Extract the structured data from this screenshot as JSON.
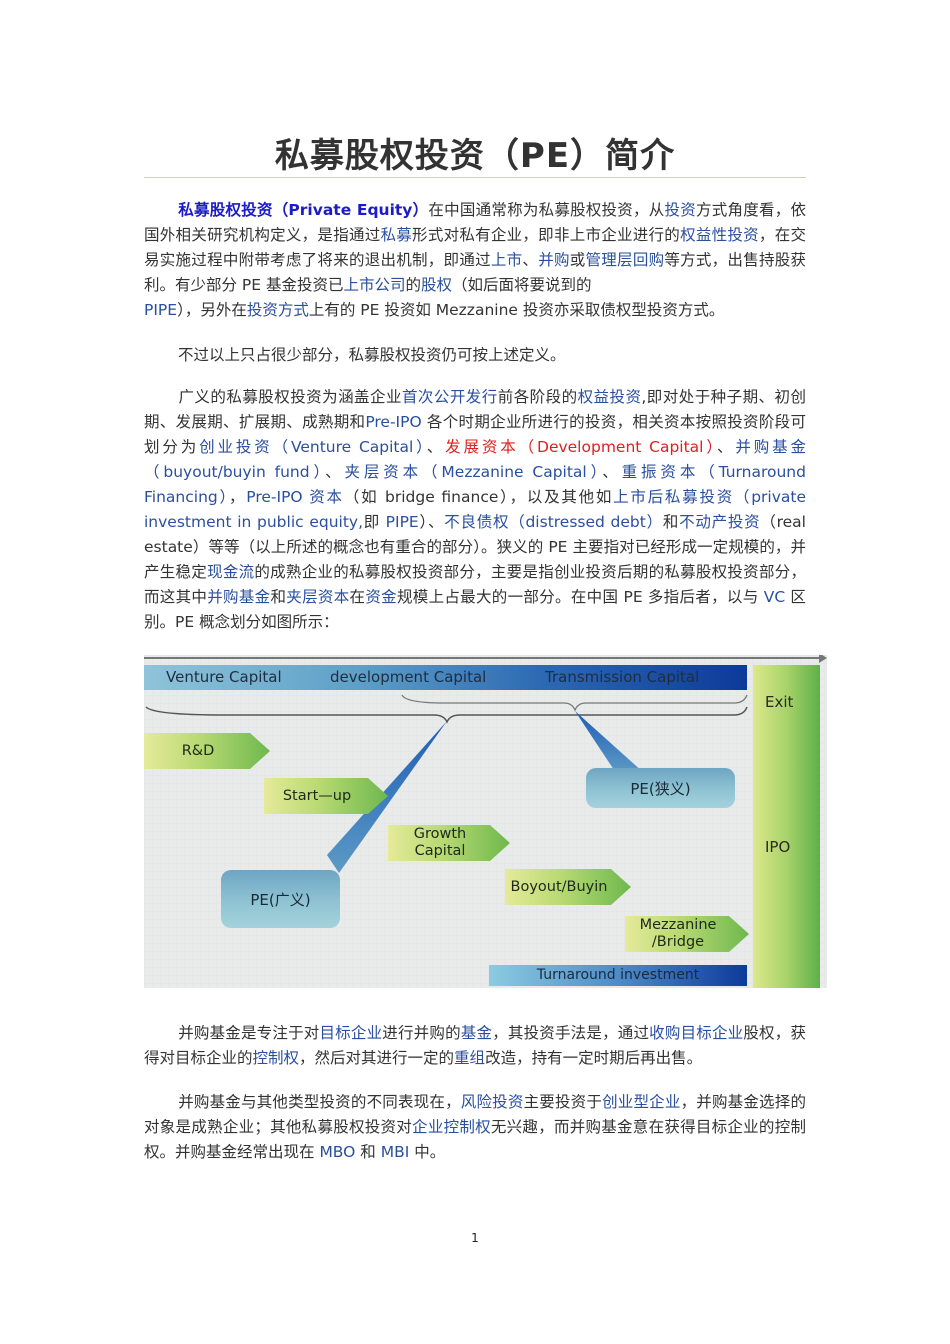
{
  "title": "私募股权投资（PE）简介",
  "paragraphs": {
    "p1": {
      "lead": "私募股权投资（Private Equity）",
      "t1": "在中国通常称为私募股权投资，从",
      "l1": "投资",
      "t2": "方式角度看，依国外相关研究机构定义，是指通过",
      "l2": "私募",
      "t3": "形式对私有企业，即非上市企业进行的",
      "l3": "权益性投资",
      "t4": "，在交易实施过程中附带考虑了将来的退出机制，即通过",
      "l4": "上市",
      "t5": "、",
      "l5": "并购",
      "t6": "或",
      "l6": "管理层回购",
      "t7": "等方式，出售持股获利。有少部分 PE 基金投资已",
      "l7": "上市公司",
      "t8": "的",
      "l8": "股权",
      "t9": "（如后面将要说到的",
      "l9": "PIPE",
      "t10": "），另外在",
      "l10": "投资方式",
      "t11": "上有的 PE 投资如 Mezzanine 投资亦采取债权型投资方式。"
    },
    "p2": {
      "text": "不过以上只占很少部分，私募股权投资仍可按上述定义。"
    },
    "p3": {
      "t1": "广义的私募股权投资为涵盖企业",
      "l1": "首次公开发行",
      "t2": "前各阶段的",
      "l2": "权益投资",
      "t3": ",即对处于种子期、初创期、发展期、扩展期、成熟期和",
      "l3": "Pre-IPO",
      "t4": " 各个时期企业所进行的投资，相关资本按照投资阶段可划分为",
      "l4": "创业投资（Venture Capital）",
      "t5": "、",
      "r1": "发展资本（Development Capital）",
      "t6": "、",
      "l5": "并购基金（buyout/buyin fund）",
      "t7": "、",
      "l6": "夹层资本（Mezzanine Capital）",
      "t8": "、",
      "l7": "重振资本（Turnaround Financing）",
      "t9": "，",
      "l8": "Pre-IPO 资本",
      "t10": "（如 bridge finance），以及其他如",
      "l9": "上市后私募投资（private investment in public equity,",
      "t11": "即 ",
      "l10": "PIPE",
      "t12": "）、",
      "l11": "不良债权（distressed debt）",
      "t13": "和",
      "l12": "不动产投资",
      "t14": "（real estate）等等（以上所述的概念也有重合的部分）。狭义的 PE 主要指对已经形成一定规模的，并产生稳定",
      "l13": "现金流",
      "t15": "的成熟企业的私募股权投资部分，主要是指创业投资后期的私募股权投资部分，而这其中",
      "l14": "并购基金",
      "t16": "和",
      "l15": "夹层资本",
      "t17": "在",
      "l16": "资金",
      "t18": "规模上占最大的一部分。在中国 PE 多指后者，以与 ",
      "l17": "VC",
      "t19": " 区别。PE 概念划分如图所示："
    },
    "p4": {
      "t1": "并购基金是专注于对",
      "l1": "目标企业",
      "t2": "进行并购的",
      "l2": "基金",
      "t3": "，其投资手法是，通过",
      "l3": "收购目标企业",
      "t4": "股权，获得对目标企业的",
      "l4": "控制权",
      "t5": "，然后对其进行一定的",
      "l5": "重组",
      "t6": "改造，持有一定时期后再出售。"
    },
    "p5": {
      "t1": "并购基金与其他类型投资的不同表现在，",
      "l1": "风险投资",
      "t2": "主要投资于",
      "l2": "创业型企业",
      "t3": "，并购基金选择的对象是成熟企业；其他私募股权投资对",
      "l3": "企业控制权",
      "t4": "无兴趣，而并购基金意在获得目标企业的控制权。并购基金经常出现在 ",
      "l4": "MBO",
      "t5": " 和 ",
      "l5": "MBI",
      "t6": " 中。"
    }
  },
  "diagram": {
    "top_bar": [
      "Venture  Capital",
      "development  Capital",
      "Transmission  Capital"
    ],
    "exit_bar": {
      "exit": "Exit",
      "ipo": "IPO"
    },
    "stages": [
      "R&D",
      "Start—up",
      "Growth\nCapital",
      "Boyout/Buyin",
      "Mezzanine\n/Bridge"
    ],
    "pe_broad": "PE(广义)",
    "pe_narrow": "PE(狭义)",
    "turnaround": "Turnaround  investment"
  },
  "colors": {
    "link": "#2a4fa0",
    "lead": "#1b1bc9",
    "highlight_red": "#e02020"
  },
  "page_number": "1"
}
